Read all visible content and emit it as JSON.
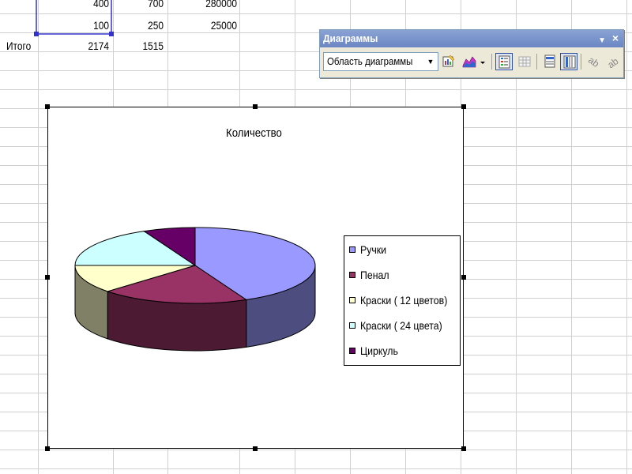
{
  "sheet": {
    "rows": [
      {
        "label": "",
        "values": [
          "400",
          "700",
          "280000"
        ]
      },
      {
        "label": "",
        "values": [
          "100",
          "250",
          "25000"
        ]
      },
      {
        "label": "Итого",
        "values": [
          "2174",
          "1515",
          ""
        ]
      }
    ]
  },
  "toolbar": {
    "title": "Диаграммы",
    "menu_glyph": "▼",
    "close_glyph": "×",
    "chart_object_value": "Область диаграммы",
    "buttons": [
      {
        "icon": "format-chart-area-icon"
      },
      {
        "icon": "chart-type-icon"
      },
      {
        "icon": "legend-icon"
      },
      {
        "icon": "data-table-icon"
      },
      {
        "icon": "by-row-icon"
      },
      {
        "icon": "by-column-icon"
      },
      {
        "icon": "angle-text-downward-icon"
      },
      {
        "icon": "angle-text-upward-icon"
      }
    ]
  },
  "chart_data": {
    "type": "pie",
    "title": "Количество",
    "three_d": true,
    "legend_position": "right",
    "series": [
      {
        "values": [
          43,
          20,
          12,
          18,
          7
        ]
      }
    ],
    "categories": [
      "Ручки",
      "Пенал",
      "Краски ( 12 цветов)",
      "Краски ( 24 цвета)",
      "Циркуль"
    ],
    "colors": [
      "#9999ff",
      "#993366",
      "#ffffcc",
      "#ccffff",
      "#660066"
    ]
  }
}
